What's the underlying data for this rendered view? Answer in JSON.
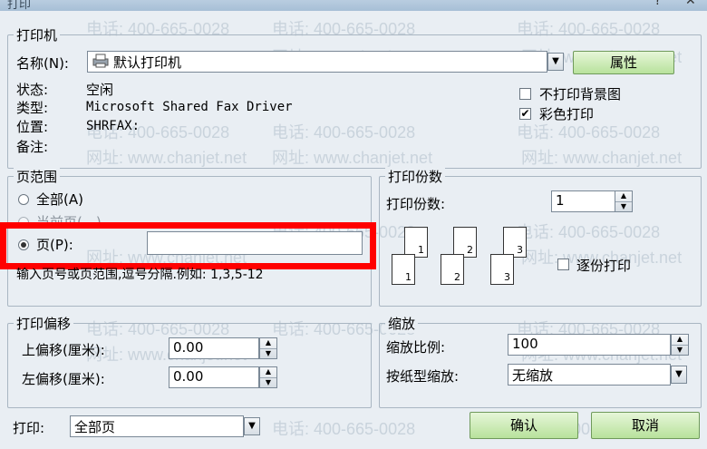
{
  "window": {
    "title": "打印"
  },
  "printer": {
    "group_label": "打印机",
    "name_label": "名称(N):",
    "name_value": "默认打印机",
    "properties_button": "属性",
    "status_label": "状态:",
    "status_value": "空闲",
    "type_label": "类型:",
    "type_value": "Microsoft Shared Fax Driver",
    "location_label": "位置:",
    "location_value": "SHRFAX:",
    "comment_label": "备注:",
    "no_background_label": "不打印背景图",
    "no_background_checked": false,
    "color_print_label": "彩色打印",
    "color_print_checked": true
  },
  "page_range": {
    "group_label": "页范围",
    "all_label": "全部(A)",
    "current_label": "当前页(…)",
    "pages_label": "页(P):",
    "pages_value": "",
    "selected": "pages",
    "hint": "输入页号或页范围,逗号分隔.例如: 1,3,5-12"
  },
  "copies": {
    "group_label": "打印份数",
    "copies_label": "打印份数:",
    "copies_value": "1",
    "collate_label": "逐份打印",
    "collate_checked": false,
    "pages_icons": [
      "1",
      "2",
      "3"
    ]
  },
  "offset": {
    "group_label": "打印偏移",
    "top_label": "上偏移(厘米):",
    "top_value": "0.00",
    "left_label": "左偏移(厘米):",
    "left_value": "0.00"
  },
  "zoom": {
    "group_label": "缩放",
    "ratio_label": "缩放比例:",
    "ratio_value": "100",
    "fit_label": "按纸型缩放:",
    "fit_value": "无缩放"
  },
  "footer": {
    "print_label": "打印:",
    "print_value": "全部页",
    "ok_button": "确认",
    "cancel_button": "取消"
  },
  "watermark": {
    "phone": "电话: 400-665-0028",
    "site": "网址: www.chanjet.net"
  },
  "colors": {
    "highlight": "#ff0000",
    "button_green": "#b8e29c"
  }
}
